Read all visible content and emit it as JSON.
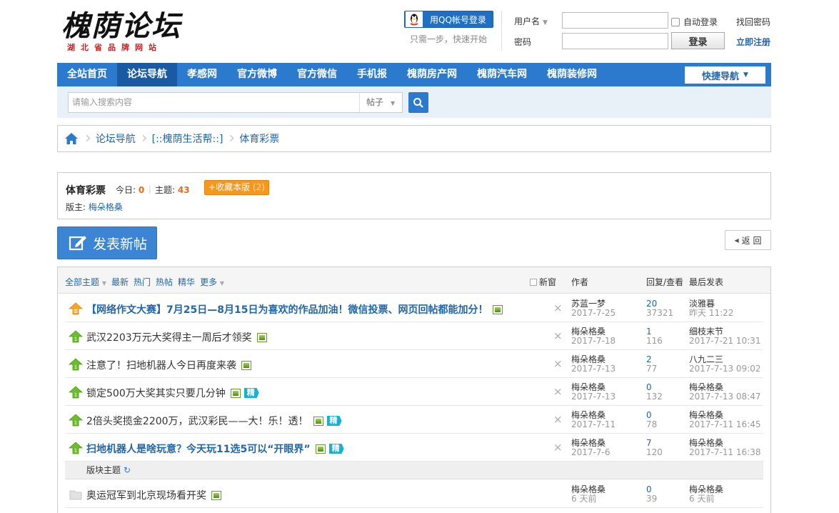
{
  "header": {
    "logo_main": "槐荫论坛",
    "logo_sub": "湖北省品牌网站",
    "qq_login": "用QQ帐号登录",
    "qq_tip": "只需一步，快速开始",
    "username_label": "用户名",
    "password_label": "密码",
    "auto_login": "自动登录",
    "login_button": "登录",
    "find_password": "找回密码",
    "register": "立即注册"
  },
  "nav": {
    "items": [
      {
        "label": "全站首页"
      },
      {
        "label": "论坛导航"
      },
      {
        "label": "孝感网"
      },
      {
        "label": "官方微博"
      },
      {
        "label": "官方微信"
      },
      {
        "label": "手机报"
      },
      {
        "label": "槐荫房产网"
      },
      {
        "label": "槐荫汽车网"
      },
      {
        "label": "槐荫装修网"
      }
    ],
    "active_index": 1,
    "quick_nav": "快捷导航"
  },
  "search": {
    "placeholder": "请输入搜索内容",
    "type": "帖子"
  },
  "breadcrumb": {
    "items": [
      "论坛导航",
      "[::槐荫生活帮::]",
      "体育彩票"
    ]
  },
  "forum": {
    "name": "体育彩票",
    "today_label": "今日:",
    "today_value": "0",
    "topics_label": "主题:",
    "topics_value": "43",
    "favorite_label": "+收藏本版",
    "favorite_count": "(2)",
    "moderator_label": "版主:",
    "moderator": "梅朵格桑"
  },
  "actions": {
    "new_post": "发表新帖",
    "back": "返 回"
  },
  "thread_list": {
    "filters": [
      "全部主题",
      "最新",
      "热门",
      "热帖",
      "精华",
      "更多"
    ],
    "new_window": "新窗",
    "col_author": "作者",
    "col_replies": "回复/查看",
    "col_last": "最后发表",
    "section_label": "版块主题",
    "rows": [
      {
        "title": "【网络作文大赛】7月25日—8月15日为喜欢的作品加油！微信投票、网页回帖都能加分！",
        "bold": true,
        "sticky": true,
        "jing": false,
        "author": "苏蓝一梦",
        "date": "2017-7-25",
        "replies": "20",
        "views": "37321",
        "last_user": "淡雅暮",
        "last_time": "昨天 11:22"
      },
      {
        "title": "武汉2203万元大奖得主一周后才领奖",
        "bold": false,
        "sticky": false,
        "jing": false,
        "author": "梅朵格桑",
        "date": "2017-7-18",
        "replies": "1",
        "views": "116",
        "last_user": "细枝末节",
        "last_time": "2017-7-21 10:31"
      },
      {
        "title": "注意了！扫地机器人今日再度来袭",
        "bold": false,
        "sticky": false,
        "jing": false,
        "author": "梅朵格桑",
        "date": "2017-7-13",
        "replies": "2",
        "views": "77",
        "last_user": "八九二三",
        "last_time": "2017-7-13 09:02"
      },
      {
        "title": "锁定500万大奖其实只要几分钟",
        "bold": false,
        "sticky": false,
        "jing": true,
        "author": "梅朵格桑",
        "date": "2017-7-13",
        "replies": "0",
        "views": "132",
        "last_user": "梅朵格桑",
        "last_time": "2017-7-13 08:47"
      },
      {
        "title": "2倍头奖揽金2200万，武汉彩民——大！乐！透！",
        "bold": false,
        "sticky": false,
        "jing": true,
        "author": "梅朵格桑",
        "date": "2017-7-11",
        "replies": "0",
        "views": "78",
        "last_user": "梅朵格桑",
        "last_time": "2017-7-11 16:45"
      },
      {
        "title": "扫地机器人是啥玩意？今天玩11选5可以“开眼界”",
        "bold": true,
        "sticky": false,
        "jing": true,
        "author": "梅朵格桑",
        "date": "2017-7-6",
        "replies": "7",
        "views": "120",
        "last_user": "梅朵格桑",
        "last_time": "2017-7-11 16:38"
      }
    ],
    "normal_rows": [
      {
        "title": "奥运冠军到北京现场看开奖",
        "author": "梅朵格桑",
        "date": "6 天前",
        "replies": "0",
        "views": "39",
        "last_user": "梅朵格桑",
        "last_time": "6 天前"
      }
    ],
    "jing_label": "精"
  },
  "colors": {
    "nav_bg": "#2b7acd",
    "nav_active": "#1a5aa3",
    "link": "#2366a8",
    "accent_orange": "#f8961e",
    "stat_number": "#e96b1a"
  }
}
